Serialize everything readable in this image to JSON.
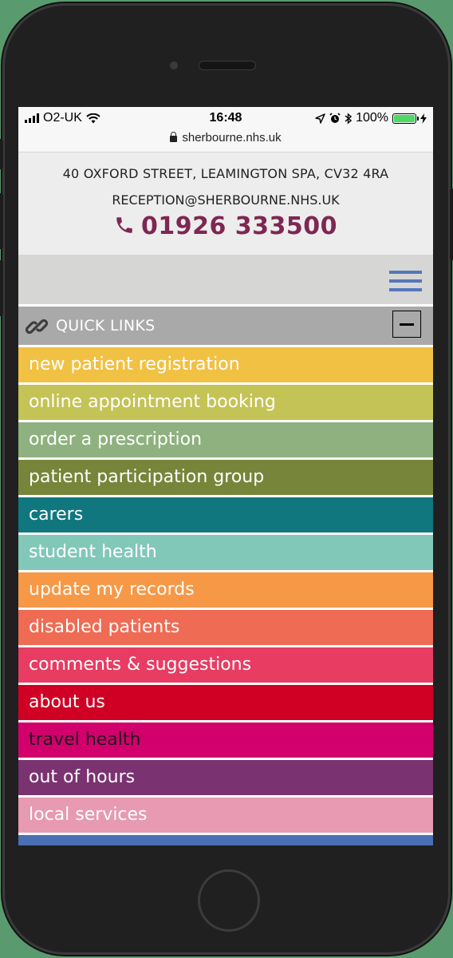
{
  "status_bar": {
    "carrier": "O2-UK",
    "time": "16:48",
    "battery": "100%",
    "url": "sherbourne.nhs.uk"
  },
  "header": {
    "address": "40 OXFORD STREET, LEAMINGTON SPA, CV32 4RA",
    "email": "RECEPTION@SHERBOURNE.NHS.UK",
    "phone": "01926 333500",
    "phone_icon": "phone-icon",
    "phone_color": "#7e2752"
  },
  "nav": {
    "menu_icon": "hamburger-menu-icon",
    "menu_color": "#5577bb"
  },
  "quick_links": {
    "title": "QUICK LINKS",
    "icon": "link-icon",
    "toggle_icon": "minus-icon",
    "items": [
      {
        "label": "new patient registration",
        "color": "#f1c143"
      },
      {
        "label": "online appointment booking",
        "color": "#c4c356"
      },
      {
        "label": "order a prescription",
        "color": "#8fb17f"
      },
      {
        "label": "patient participation group",
        "color": "#76853a"
      },
      {
        "label": "carers",
        "color": "#11777f"
      },
      {
        "label": "student health",
        "color": "#82c8b9"
      },
      {
        "label": "update my records",
        "color": "#f79846"
      },
      {
        "label": "disabled patients",
        "color": "#ef6b53"
      },
      {
        "label": "comments & suggestions",
        "color": "#e83c63"
      },
      {
        "label": "about us",
        "color": "#d00025"
      },
      {
        "label": "travel health",
        "color": "#d2006d"
      },
      {
        "label": "out of hours",
        "color": "#7b3270"
      },
      {
        "label": "local services",
        "color": "#e79ab2"
      }
    ]
  }
}
